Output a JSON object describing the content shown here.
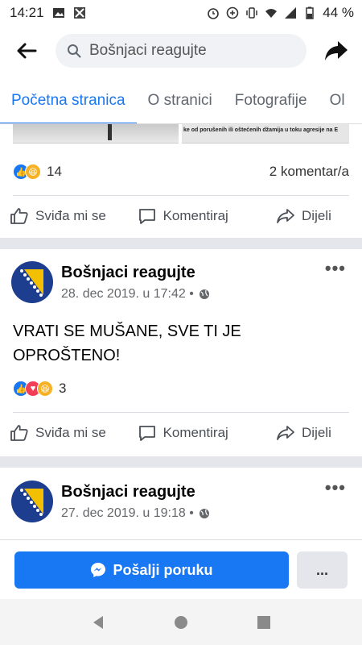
{
  "status_bar": {
    "time": "14:21",
    "battery": "44 %"
  },
  "search": {
    "value": "Bošnjaci reagujte"
  },
  "tabs": [
    {
      "label": "Početna stranica"
    },
    {
      "label": "O stranici"
    },
    {
      "label": "Fotografije"
    },
    {
      "label": "Ol"
    }
  ],
  "photo_caption": "ke od porušenih ili oštećenih džamija u toku agresije na E",
  "post_prev": {
    "reaction_count": "14",
    "comments": "2 komentar/a"
  },
  "actions": {
    "like": "Sviđa mi se",
    "comment": "Komentiraj",
    "share": "Dijeli"
  },
  "post1": {
    "author": "Bošnjaci reagujte",
    "date": "28. dec 2019. u 17:42 •",
    "text": "VRATI SE MUŠANE, SVE TI JE OPROŠTENO!",
    "reaction_count": "3"
  },
  "post2": {
    "author": "Bošnjaci reagujte",
    "date": "27. dec 2019. u 19:18 •"
  },
  "bottom": {
    "message_button": "Pošalji poruku",
    "more_button": "..."
  },
  "colors": {
    "accent": "#1877f2",
    "like": "#1877f2",
    "love": "#f33e58",
    "haha": "#f7b125",
    "flag_blue": "#1d3d8f",
    "flag_yellow": "#f2c000"
  }
}
